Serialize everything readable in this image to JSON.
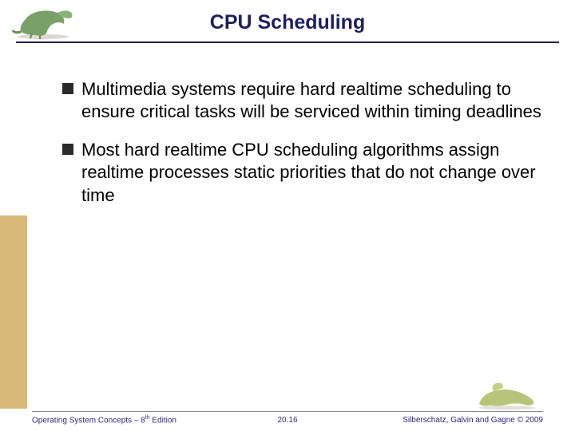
{
  "title": "CPU Scheduling",
  "bullets": [
    "Multimedia systems require hard realtime scheduling to ensure critical tasks will be serviced within timing deadlines",
    "Most hard realtime CPU scheduling algorithms assign realtime processes static priorities that do not change over time"
  ],
  "footer": {
    "left_prefix": "Operating System Concepts – 8",
    "left_sup": "th",
    "left_suffix": " Edition",
    "center": "20.16",
    "right": "Silberschatz, Galvin and Gagne © 2009"
  },
  "icons": {
    "header_dino": "dinosaur-icon",
    "footer_dino": "dinosaur-footer-icon"
  },
  "colors": {
    "title": "#1f1f5c",
    "sidebar": "#d9b97a"
  }
}
